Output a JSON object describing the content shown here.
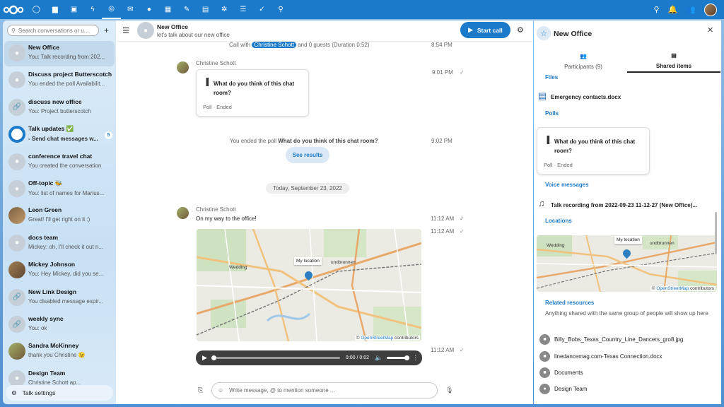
{
  "topbar": {
    "apps": [
      {
        "icon": "dashboard-icon",
        "glyph": "◯"
      },
      {
        "icon": "files-icon",
        "glyph": "▆"
      },
      {
        "icon": "photos-icon",
        "glyph": "▣"
      },
      {
        "icon": "activity-icon",
        "glyph": "ϟ"
      },
      {
        "icon": "talk-icon",
        "glyph": "◎"
      },
      {
        "icon": "mail-icon",
        "glyph": "✉"
      },
      {
        "icon": "contacts-icon",
        "glyph": "●"
      },
      {
        "icon": "calendar-icon",
        "glyph": "▦"
      },
      {
        "icon": "notes-icon",
        "glyph": "✎"
      },
      {
        "icon": "deck-icon",
        "glyph": "▤"
      },
      {
        "icon": "weather-icon",
        "glyph": "✲"
      },
      {
        "icon": "lists-icon",
        "glyph": "☰"
      },
      {
        "icon": "tasks-icon",
        "glyph": "✓"
      },
      {
        "icon": "maps-icon",
        "glyph": "⚲"
      }
    ],
    "right": [
      {
        "icon": "search-icon",
        "glyph": "⚲"
      },
      {
        "icon": "notifications-icon",
        "glyph": "🔔"
      },
      {
        "icon": "contacts-menu-icon",
        "glyph": "👥"
      }
    ]
  },
  "sidebar": {
    "search_placeholder": "Search conversations or u...",
    "plus": "+",
    "conversations": [
      {
        "name": "New Office",
        "last": "You: Talk recording from 202...",
        "active": true,
        "avatar": "group"
      },
      {
        "name": "Discuss project Butterscotch",
        "last": "You ended the poll Availabilit...",
        "avatar": "group"
      },
      {
        "name": "discuss new office",
        "last": "You: Project butterscotch",
        "avatar": "link"
      },
      {
        "name": "Talk updates ✅",
        "last": "- Send chat messages w...",
        "bold": true,
        "badge": "5",
        "avatar": "talk"
      },
      {
        "name": "conference travel chat",
        "last": "You created the conversation",
        "avatar": "group"
      },
      {
        "name": "Off-topic 🐝",
        "last": "You: list of names for Marius...",
        "avatar": "group"
      },
      {
        "name": "Leon Green",
        "last": "Great! I'll get right on it :)",
        "avatar": "photo1"
      },
      {
        "name": "docs team",
        "last": "Mickey: oh, I'll check it out n...",
        "avatar": "group"
      },
      {
        "name": "Mickey Johnson",
        "last": "You: Hey Mickey, did you se...",
        "avatar": "photo2"
      },
      {
        "name": "New Link Design",
        "last": "You disabled message expir...",
        "avatar": "link"
      },
      {
        "name": "weekly sync",
        "last": "You: ok",
        "avatar": "link"
      },
      {
        "name": "Sandra McKinney",
        "last": "thank you Christine 😉",
        "avatar": "photo3"
      },
      {
        "name": "Design Team",
        "last": "Christine Schott ap...",
        "avatar": "group"
      }
    ],
    "settings_label": "Talk settings"
  },
  "chat": {
    "title": "New Office",
    "subtitle": "let's talk about our new office",
    "start_call": "Start call",
    "call_prefix": "Call with",
    "call_person": "Christine Schott",
    "call_suffix": "and 0 guests (Duration 0:52)",
    "call_time": "8:54 PM",
    "author1": "Christine Schott",
    "poll_time": "9:01 PM",
    "poll_question": "What do you think of this chat room?",
    "poll_status": "Poll · Ended",
    "ended_prefix": "You ended the poll",
    "ended_question": "What do you think of this chat room?",
    "ended_time": "9:02 PM",
    "see_results": "See results",
    "date_separator": "Today, September 23, 2022",
    "author2": "Christine Schott",
    "message": "On my way to the office!",
    "msg_time1": "11:12 AM",
    "msg_time2": "11:12 AM",
    "audio_time": "11:12 AM",
    "map_pin_label": "My location",
    "map_labels": [
      "Wedding",
      "undbrunnen"
    ],
    "map_credit_prefix": "©",
    "map_credit_link": "OpenStreetMap",
    "map_credit_suffix": "contributors",
    "audio_progress": "0:00 / 0:02",
    "composer_placeholder": "Write message, @ to mention someone ..."
  },
  "panel": {
    "title": "New Office",
    "tab_participants": "Participants (9)",
    "tab_shared": "Shared items",
    "files_heading": "Files",
    "file_name": "Emergency contacts.docx",
    "polls_heading": "Polls",
    "poll_question": "What do you think of this chat room?",
    "poll_status": "Poll · Ended",
    "voice_heading": "Voice messages",
    "voice_item": "Talk recording from 2022-09-23 11-12-27 (New Office)...",
    "locations_heading": "Locations",
    "related_heading": "Related resources",
    "related_desc": "Anything shared with the same group of people will show up here",
    "resources": [
      "Billy_Bobs_Texas_Country_Line_Dancers_gro8.jpg",
      "linedancemag.com-Texas Connection.docx",
      "Documents",
      "Design Team"
    ]
  }
}
